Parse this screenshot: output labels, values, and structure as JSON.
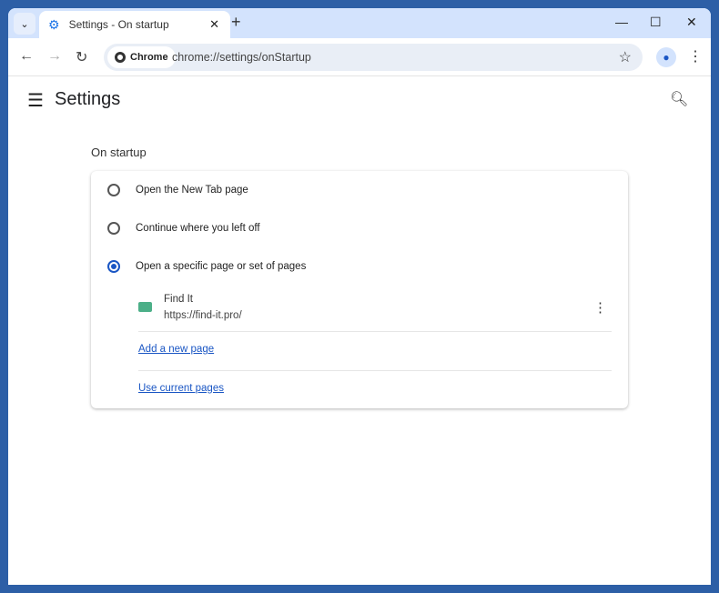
{
  "tab": {
    "title": "Settings - On startup"
  },
  "omnibox": {
    "chip": "Chrome",
    "url": "chrome://settings/onStartup"
  },
  "header": {
    "title": "Settings"
  },
  "section": {
    "title": "On startup"
  },
  "options": [
    "Open the New Tab page",
    "Continue where you left off",
    "Open a specific page or set of pages"
  ],
  "selected_option": 2,
  "startup_page": {
    "name": "Find It",
    "url": "https://find-it.pro/"
  },
  "links": {
    "add": "Add a new page",
    "use_current": "Use current pages"
  },
  "colors": {
    "accent": "#1a56c4",
    "frame": "#2d5fa6",
    "tabstrip": "#d3e3fd"
  }
}
